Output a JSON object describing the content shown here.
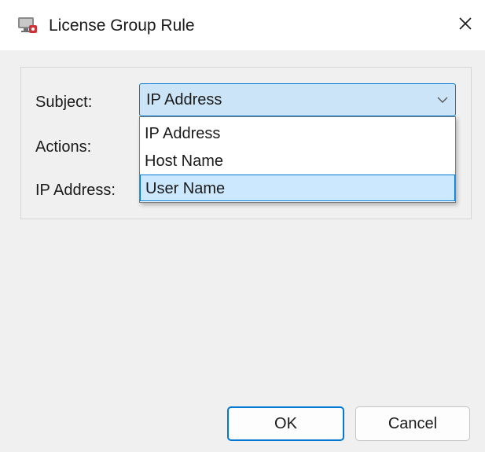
{
  "window": {
    "title": "License Group Rule"
  },
  "form": {
    "subject_label": "Subject:",
    "actions_label": "Actions:",
    "ip_label": "IP Address:",
    "subject_value": "IP Address",
    "options": [
      "IP Address",
      "Host Name",
      "User Name"
    ],
    "highlighted_option": "User Name"
  },
  "buttons": {
    "ok": "OK",
    "cancel": "Cancel"
  },
  "colors": {
    "accent": "#0078d4",
    "selection": "#cce8ff",
    "window_bg": "#f0f0f0"
  },
  "icons": {
    "app": "network-monitor-icon",
    "close": "close-icon",
    "dropdown": "chevron-down-icon"
  }
}
